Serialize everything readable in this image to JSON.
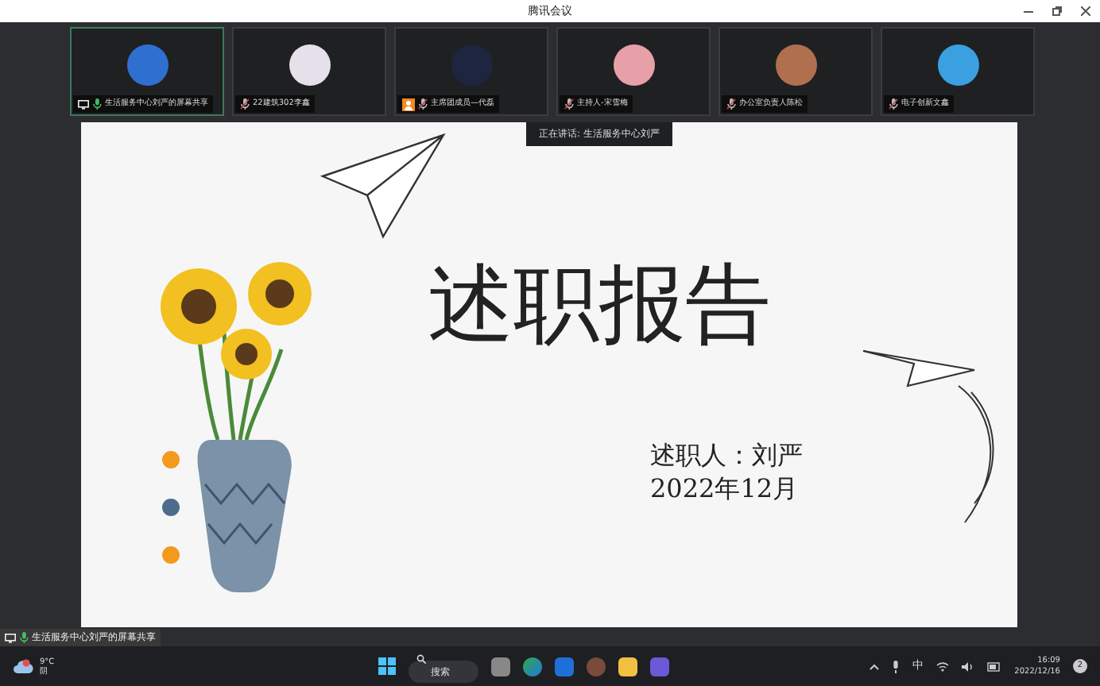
{
  "window": {
    "title": "腾讯会议"
  },
  "participants": [
    {
      "name": "生活服务中心刘严的屏幕共享",
      "speaking": true,
      "sharing": true,
      "role_icon": false
    },
    {
      "name": "22建筑302李鑫",
      "speaking": false,
      "sharing": false,
      "role_icon": false
    },
    {
      "name": "主席团成员—代磊",
      "speaking": false,
      "sharing": false,
      "role_icon": true
    },
    {
      "name": "主持人-宋雪梅",
      "speaking": false,
      "sharing": false,
      "role_icon": false
    },
    {
      "name": "办公室负责人陈松",
      "speaking": false,
      "sharing": false,
      "role_icon": false
    },
    {
      "name": "电子创新文鑫",
      "speaking": false,
      "sharing": false,
      "role_icon": false
    }
  ],
  "speaker_banner": "正在讲话: 生活服务中心刘严",
  "slide": {
    "title": "述职报告",
    "presenter": "述职人：刘严",
    "date": "2022年12月",
    "dots": [
      {
        "color": "#f39a1e"
      },
      {
        "color": "#4d6b8c"
      },
      {
        "color": "#f39a1e"
      }
    ]
  },
  "share_label": "生活服务中心刘严的屏幕共享",
  "taskbar": {
    "temperature": "9°C",
    "condition": "阴",
    "search": {
      "placeholder": "搜索"
    },
    "ime": "中",
    "time": "16:09",
    "date": "2022/12/16",
    "notifications": "2"
  }
}
